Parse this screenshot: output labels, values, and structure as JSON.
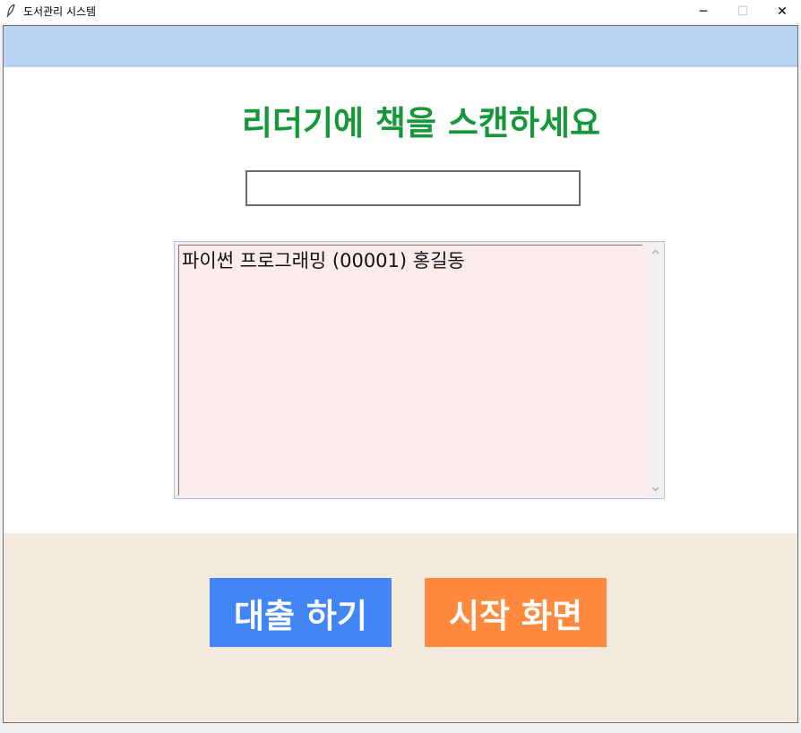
{
  "window": {
    "title": "도서관리 시스템",
    "controls": {
      "minimize": "─",
      "maximize": "☐",
      "close": "✕"
    }
  },
  "main": {
    "heading": "리더기에 책을 스캔하세요",
    "scan_input": {
      "value": "",
      "placeholder": ""
    },
    "scanned_items": [
      "파이썬 프로그래밍 (00001) 홍길동"
    ]
  },
  "actions": {
    "borrow_label": "대출 하기",
    "home_label": "시작 화면"
  },
  "colors": {
    "top_strip": "#b9d1f3",
    "heading": "#16973a",
    "list_background": "#fdecee",
    "bottom_panel": "#f3e9dc",
    "borrow_button": "#4285f4",
    "home_button": "#ff8a3d"
  },
  "icons": {
    "app": "feather-icon",
    "scroll_up": "chevron-up-icon",
    "scroll_down": "chevron-down-icon"
  }
}
